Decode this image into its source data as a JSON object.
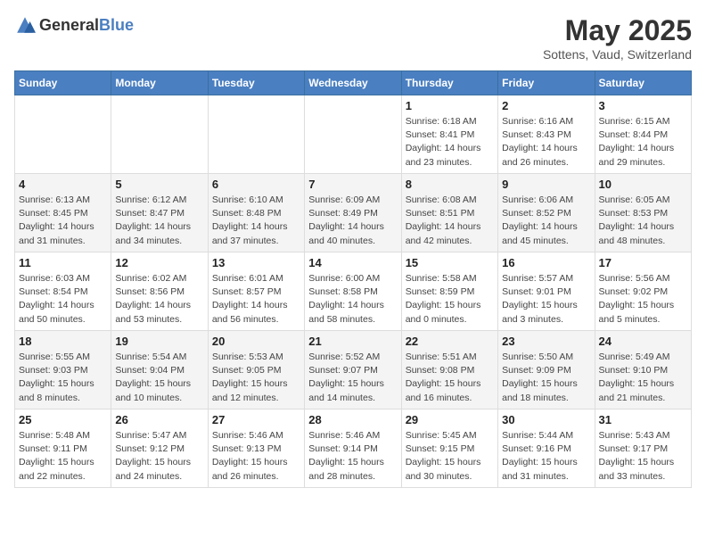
{
  "header": {
    "logo_general": "General",
    "logo_blue": "Blue",
    "title": "May 2025",
    "subtitle": "Sottens, Vaud, Switzerland"
  },
  "weekdays": [
    "Sunday",
    "Monday",
    "Tuesday",
    "Wednesday",
    "Thursday",
    "Friday",
    "Saturday"
  ],
  "rows": [
    [
      {
        "day": "",
        "info": ""
      },
      {
        "day": "",
        "info": ""
      },
      {
        "day": "",
        "info": ""
      },
      {
        "day": "",
        "info": ""
      },
      {
        "day": "1",
        "info": "Sunrise: 6:18 AM\nSunset: 8:41 PM\nDaylight: 14 hours\nand 23 minutes."
      },
      {
        "day": "2",
        "info": "Sunrise: 6:16 AM\nSunset: 8:43 PM\nDaylight: 14 hours\nand 26 minutes."
      },
      {
        "day": "3",
        "info": "Sunrise: 6:15 AM\nSunset: 8:44 PM\nDaylight: 14 hours\nand 29 minutes."
      }
    ],
    [
      {
        "day": "4",
        "info": "Sunrise: 6:13 AM\nSunset: 8:45 PM\nDaylight: 14 hours\nand 31 minutes."
      },
      {
        "day": "5",
        "info": "Sunrise: 6:12 AM\nSunset: 8:47 PM\nDaylight: 14 hours\nand 34 minutes."
      },
      {
        "day": "6",
        "info": "Sunrise: 6:10 AM\nSunset: 8:48 PM\nDaylight: 14 hours\nand 37 minutes."
      },
      {
        "day": "7",
        "info": "Sunrise: 6:09 AM\nSunset: 8:49 PM\nDaylight: 14 hours\nand 40 minutes."
      },
      {
        "day": "8",
        "info": "Sunrise: 6:08 AM\nSunset: 8:51 PM\nDaylight: 14 hours\nand 42 minutes."
      },
      {
        "day": "9",
        "info": "Sunrise: 6:06 AM\nSunset: 8:52 PM\nDaylight: 14 hours\nand 45 minutes."
      },
      {
        "day": "10",
        "info": "Sunrise: 6:05 AM\nSunset: 8:53 PM\nDaylight: 14 hours\nand 48 minutes."
      }
    ],
    [
      {
        "day": "11",
        "info": "Sunrise: 6:03 AM\nSunset: 8:54 PM\nDaylight: 14 hours\nand 50 minutes."
      },
      {
        "day": "12",
        "info": "Sunrise: 6:02 AM\nSunset: 8:56 PM\nDaylight: 14 hours\nand 53 minutes."
      },
      {
        "day": "13",
        "info": "Sunrise: 6:01 AM\nSunset: 8:57 PM\nDaylight: 14 hours\nand 56 minutes."
      },
      {
        "day": "14",
        "info": "Sunrise: 6:00 AM\nSunset: 8:58 PM\nDaylight: 14 hours\nand 58 minutes."
      },
      {
        "day": "15",
        "info": "Sunrise: 5:58 AM\nSunset: 8:59 PM\nDaylight: 15 hours\nand 0 minutes."
      },
      {
        "day": "16",
        "info": "Sunrise: 5:57 AM\nSunset: 9:01 PM\nDaylight: 15 hours\nand 3 minutes."
      },
      {
        "day": "17",
        "info": "Sunrise: 5:56 AM\nSunset: 9:02 PM\nDaylight: 15 hours\nand 5 minutes."
      }
    ],
    [
      {
        "day": "18",
        "info": "Sunrise: 5:55 AM\nSunset: 9:03 PM\nDaylight: 15 hours\nand 8 minutes."
      },
      {
        "day": "19",
        "info": "Sunrise: 5:54 AM\nSunset: 9:04 PM\nDaylight: 15 hours\nand 10 minutes."
      },
      {
        "day": "20",
        "info": "Sunrise: 5:53 AM\nSunset: 9:05 PM\nDaylight: 15 hours\nand 12 minutes."
      },
      {
        "day": "21",
        "info": "Sunrise: 5:52 AM\nSunset: 9:07 PM\nDaylight: 15 hours\nand 14 minutes."
      },
      {
        "day": "22",
        "info": "Sunrise: 5:51 AM\nSunset: 9:08 PM\nDaylight: 15 hours\nand 16 minutes."
      },
      {
        "day": "23",
        "info": "Sunrise: 5:50 AM\nSunset: 9:09 PM\nDaylight: 15 hours\nand 18 minutes."
      },
      {
        "day": "24",
        "info": "Sunrise: 5:49 AM\nSunset: 9:10 PM\nDaylight: 15 hours\nand 21 minutes."
      }
    ],
    [
      {
        "day": "25",
        "info": "Sunrise: 5:48 AM\nSunset: 9:11 PM\nDaylight: 15 hours\nand 22 minutes."
      },
      {
        "day": "26",
        "info": "Sunrise: 5:47 AM\nSunset: 9:12 PM\nDaylight: 15 hours\nand 24 minutes."
      },
      {
        "day": "27",
        "info": "Sunrise: 5:46 AM\nSunset: 9:13 PM\nDaylight: 15 hours\nand 26 minutes."
      },
      {
        "day": "28",
        "info": "Sunrise: 5:46 AM\nSunset: 9:14 PM\nDaylight: 15 hours\nand 28 minutes."
      },
      {
        "day": "29",
        "info": "Sunrise: 5:45 AM\nSunset: 9:15 PM\nDaylight: 15 hours\nand 30 minutes."
      },
      {
        "day": "30",
        "info": "Sunrise: 5:44 AM\nSunset: 9:16 PM\nDaylight: 15 hours\nand 31 minutes."
      },
      {
        "day": "31",
        "info": "Sunrise: 5:43 AM\nSunset: 9:17 PM\nDaylight: 15 hours\nand 33 minutes."
      }
    ]
  ]
}
